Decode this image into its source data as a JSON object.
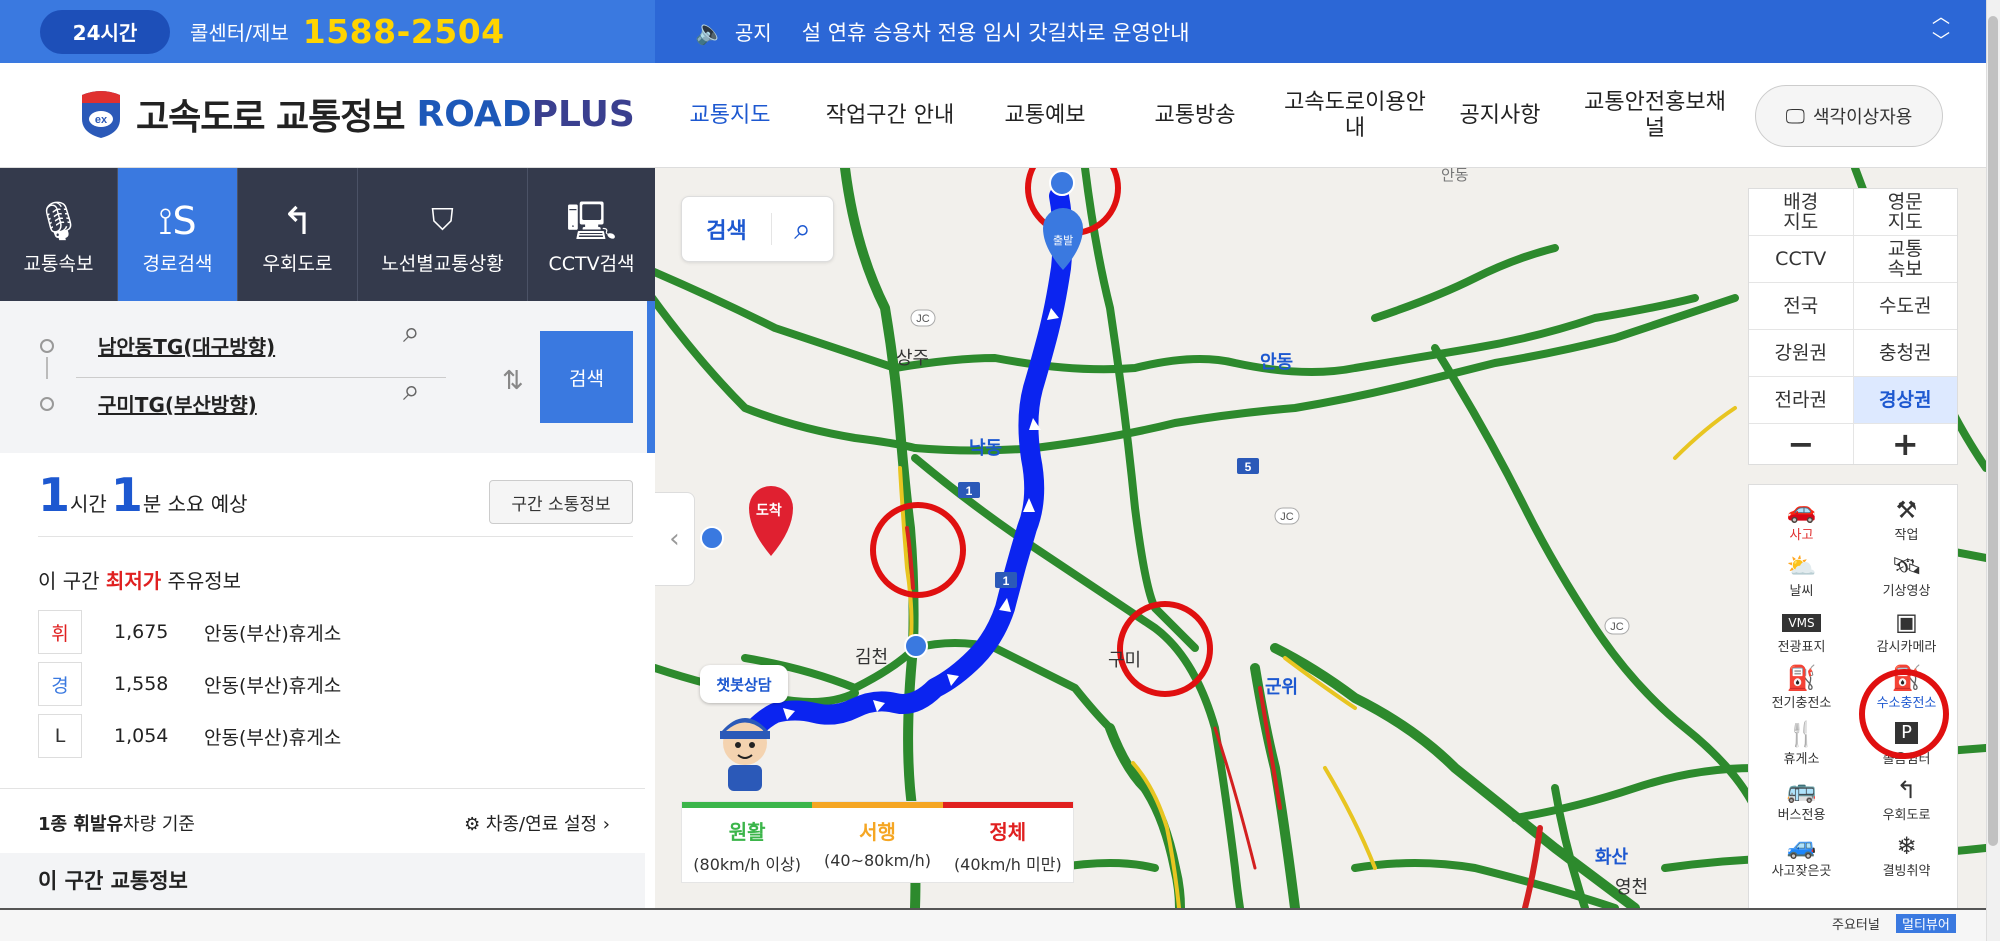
{
  "topbar": {
    "badge": "24시간",
    "callcenter": "콜센터/제보",
    "phone": "1588-2504",
    "notice_label": "공지",
    "notice_text": "설 연휴 승용차 전용 임시 갓길차로 운영안내"
  },
  "header": {
    "logo_title": "고속도로 교통정보",
    "logo_brand_a": "ROAD",
    "logo_brand_b": "PLUS",
    "nav": [
      "교통지도",
      "작업구간 안내",
      "교통예보",
      "교통방송",
      "고속도로이용안내",
      "공지사항",
      "교통안전홍보채널"
    ],
    "nav_active": 0,
    "colorblind_button": "색각이상자용"
  },
  "sidebar": {
    "tabs": [
      {
        "label": "교통속보",
        "icon": "microphone-icon"
      },
      {
        "label": "경로검색",
        "icon": "route-icon"
      },
      {
        "label": "우회도로",
        "icon": "detour-icon"
      },
      {
        "label": "노선별교통상황",
        "icon": "route-shield-icon"
      },
      {
        "label": "CCTV검색",
        "icon": "cctv-icon"
      }
    ],
    "active_tab": 1,
    "origin": "남안동TG(대구방향)",
    "destination": "구미TG(부산방향)",
    "search_button": "검색",
    "eta": {
      "hours": "1",
      "hours_unit": "시간",
      "minutes": "1",
      "minutes_unit": "분 소요 예상"
    },
    "section_button": "구간 소통정보",
    "fuel_title_pre": "이 구간 ",
    "fuel_title_em": "최저가",
    "fuel_title_post": " 주유정보",
    "fuel": [
      {
        "type": "휘",
        "price": "1,675",
        "station": "안동(부산)휴게소",
        "color": "#e02020"
      },
      {
        "type": "경",
        "price": "1,558",
        "station": "안동(부산)휴게소",
        "color": "#3a79e0"
      },
      {
        "type": "L",
        "price": "1,054",
        "station": "안동(부산)휴게소",
        "color": "#333333"
      }
    ],
    "vehicle_basis_bold": "1종 휘발유",
    "vehicle_basis_rest": "차량 기준",
    "vehicle_settings": "차종/연료 설정",
    "traffic_info_title": "이 구간 교통정보"
  },
  "map": {
    "search_label": "검색",
    "controls": [
      [
        "배경\n지도",
        "영문\n지도"
      ],
      [
        "CCTV",
        "교통\n속보"
      ],
      [
        "전국",
        "수도권"
      ],
      [
        "강원권",
        "충청권"
      ],
      [
        "전라권",
        "경상권"
      ]
    ],
    "active_region": "경상권",
    "zoom_out": "−",
    "zoom_in": "+",
    "layers": [
      {
        "label": "사고",
        "icon": "accident-icon",
        "glyph": "🚗",
        "style": "red"
      },
      {
        "label": "작업",
        "icon": "worker-icon",
        "glyph": "⚒",
        "style": ""
      },
      {
        "label": "날씨",
        "icon": "weather-icon",
        "glyph": "⛅",
        "style": ""
      },
      {
        "label": "기상영상",
        "icon": "satellite-icon",
        "glyph": "🛰",
        "style": ""
      },
      {
        "label": "전광표지",
        "icon": "vms-icon",
        "glyph": "VMS",
        "style": ""
      },
      {
        "label": "감시카메라",
        "icon": "camera-icon",
        "glyph": "▣",
        "style": ""
      },
      {
        "label": "전기충전소",
        "icon": "ev-charger-icon",
        "glyph": "⛽",
        "style": ""
      },
      {
        "label": "수소충전소",
        "icon": "hydrogen-station-icon",
        "glyph": "⛽",
        "style": "blue"
      },
      {
        "label": "휴게소",
        "icon": "restaurant-icon",
        "glyph": "🍴",
        "style": ""
      },
      {
        "label": "졸음쉼터",
        "icon": "parking-icon",
        "glyph": "P",
        "style": ""
      },
      {
        "label": "버스전용",
        "icon": "bus-lane-icon",
        "glyph": "🚌",
        "style": ""
      },
      {
        "label": "우회도로",
        "icon": "detour-icon",
        "glyph": "↰",
        "style": ""
      },
      {
        "label": "사고잦은곳",
        "icon": "accident-prone-icon",
        "glyph": "🚙",
        "style": ""
      },
      {
        "label": "결빙취약",
        "icon": "ice-icon",
        "glyph": "❄",
        "style": ""
      }
    ],
    "place_labels": [
      "상주",
      "낙동",
      "안동",
      "김천",
      "군위",
      "구미",
      "화산",
      "영천",
      "안동"
    ],
    "arrival_marker": "도착",
    "departure_marker": "출발",
    "chatbot": "챗봇상담",
    "legend": [
      {
        "name": "원활",
        "sub": "(80km/h 이상)",
        "color": "#3bb54a"
      },
      {
        "name": "서행",
        "sub": "(40~80km/h)",
        "color": "#f5a623"
      },
      {
        "name": "정체",
        "sub": "(40km/h 미만)",
        "color": "#e02020"
      }
    ],
    "bottom_tags": [
      "주요터널",
      "멀티뷰어"
    ]
  }
}
